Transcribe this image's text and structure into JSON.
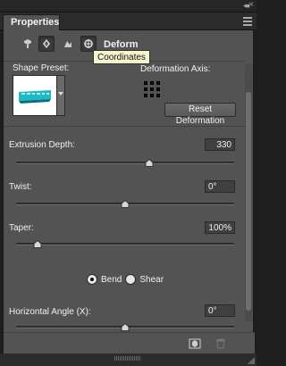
{
  "panel": {
    "tab_label": "Properties",
    "window_controls": {
      "collapse": "◂◂",
      "close": "×"
    },
    "section_title": "Deform",
    "tooltip": "Coordinates",
    "icons": [
      "mesh-icon",
      "deform-icon",
      "cap-icon",
      "coordinates-icon"
    ]
  },
  "shape": {
    "preset_label": "Shape Preset:",
    "axis_label": "Deformation Axis:",
    "reset_label": "Reset Deformation"
  },
  "properties": [
    {
      "label": "Extrusion Depth:",
      "value": "330",
      "slider_fraction": 0.61
    },
    {
      "label": "Twist:",
      "value": "0°",
      "slider_fraction": 0.5
    },
    {
      "label": "Taper:",
      "value": "100%",
      "slider_fraction": 0.1
    }
  ],
  "bend_shear": {
    "bend_label": "Bend",
    "shear_label": "Shear",
    "selected": "Bend"
  },
  "horizontal_angle": {
    "label": "Horizontal Angle (X):",
    "value": "0°",
    "slider_fraction": 0.5
  },
  "footer": {
    "icons": [
      "render-icon",
      "trash-icon"
    ]
  },
  "colors": {
    "panel_bg": "#535353",
    "tooltip_bg": "#f7f6cf",
    "preset_text": "#1fb8c6"
  }
}
